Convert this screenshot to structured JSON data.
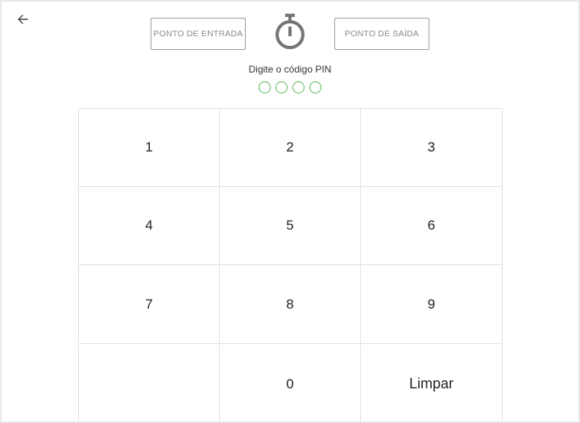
{
  "header": {
    "back_icon": "arrow-left-icon",
    "clock_in_label": "PONTO DE ENTRADA",
    "clock_out_label": "PONTO DE SAÍDA",
    "timer_icon": "stopwatch-icon"
  },
  "pin": {
    "prompt": "Digite o código PIN",
    "length": 4,
    "accent_color": "#5cb85c"
  },
  "keypad": {
    "keys": [
      "1",
      "2",
      "3",
      "4",
      "5",
      "6",
      "7",
      "8",
      "9",
      "",
      "0",
      "Limpar"
    ]
  }
}
